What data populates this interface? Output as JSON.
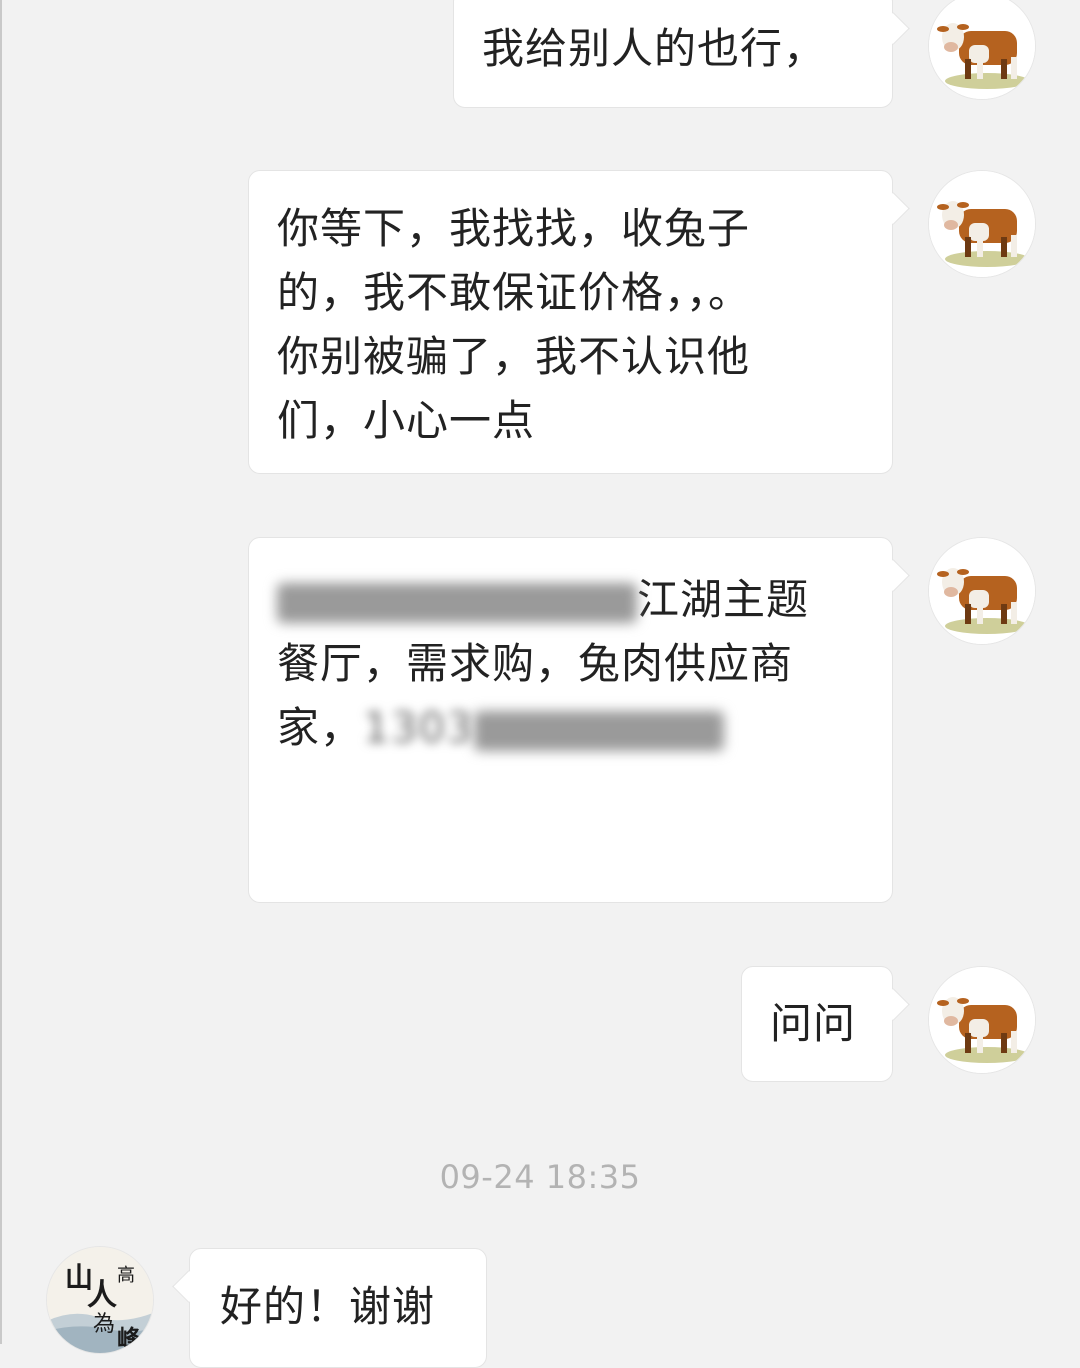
{
  "messages": [
    {
      "side": "out",
      "lines": [
        "我给别人的也行，"
      ]
    },
    {
      "side": "out",
      "lines": [
        "你等下，我找找，收兔子",
        "的，我不敢保证价格，，。",
        "你别被骗了，我不认识他",
        "们，小心一点"
      ]
    },
    {
      "side": "out",
      "line1_visible": "江湖主题",
      "line2": "餐厅，需求购，兔肉供应商",
      "line3_prefix": "家，",
      "phone_visible": "1303"
    },
    {
      "side": "out",
      "lines": [
        "问问"
      ]
    },
    {
      "side": "in",
      "lines": [
        "好的！谢谢"
      ]
    }
  ],
  "timestamp": "09-24 18:35",
  "contact_avatar": {
    "icon": "calligraphy-avatar-icon",
    "chars": [
      "山",
      "人",
      "高",
      "為",
      "峰"
    ]
  },
  "self_avatar": {
    "icon": "cow-avatar-icon"
  },
  "colors": {
    "background": "#f2f2f2",
    "bubble": "#ffffff",
    "bubble_border": "#e4e4e4",
    "text": "#222222",
    "timestamp": "#b3b3b3",
    "cow_brown": "#b5621f"
  }
}
